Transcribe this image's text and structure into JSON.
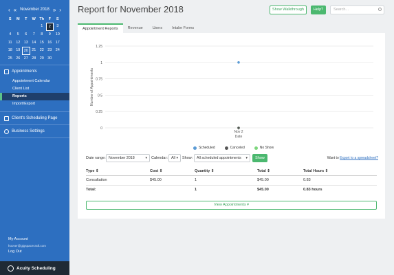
{
  "sidebar": {
    "calendar": {
      "prev": "‹",
      "next": "›",
      "month_label": "November 2018",
      "prev_year": "«",
      "next_year": "»",
      "weekdays": [
        "S",
        "M",
        "T",
        "W",
        "Th",
        "F",
        "S"
      ],
      "days": [
        {
          "d": "",
          "other": false
        },
        {
          "d": "",
          "other": false
        },
        {
          "d": "",
          "other": false
        },
        {
          "d": "",
          "other": false
        },
        {
          "d": "1",
          "other": false
        },
        {
          "d": "2",
          "selected": true
        },
        {
          "d": "3"
        },
        {
          "d": "4"
        },
        {
          "d": "5"
        },
        {
          "d": "6"
        },
        {
          "d": "7"
        },
        {
          "d": "8"
        },
        {
          "d": "9"
        },
        {
          "d": "10"
        },
        {
          "d": "11"
        },
        {
          "d": "12"
        },
        {
          "d": "13"
        },
        {
          "d": "14"
        },
        {
          "d": "15"
        },
        {
          "d": "16"
        },
        {
          "d": "17"
        },
        {
          "d": "18"
        },
        {
          "d": "19"
        },
        {
          "d": "20",
          "boxed": true
        },
        {
          "d": "21"
        },
        {
          "d": "22"
        },
        {
          "d": "23"
        },
        {
          "d": "24"
        },
        {
          "d": "25"
        },
        {
          "d": "26"
        },
        {
          "d": "27"
        },
        {
          "d": "28"
        },
        {
          "d": "29"
        },
        {
          "d": "30"
        },
        {
          "d": ""
        }
      ]
    },
    "nav": {
      "appointments": "Appointments",
      "appointment_calendar": "Appointment Calendar",
      "client_list": "Client List",
      "reports": "Reports",
      "import_export": "Import/Export",
      "scheduling_page": "Client's Scheduling Page",
      "business_settings": "Business Settings"
    },
    "account": {
      "my_account": "My Account",
      "email": "hoover@gigspacecraft.com",
      "logout": "Log Out"
    },
    "brand": "Acuity Scheduling"
  },
  "header": {
    "title": "Report for November 2018",
    "walkthrough": "Show Walkthrough",
    "help": "Help?",
    "search_placeholder": "Search..."
  },
  "tabs": [
    "Appointment Reports",
    "Revenue",
    "Users",
    "Intake Forms"
  ],
  "chart_data": {
    "type": "line",
    "ylabel": "Number of Appointments",
    "xlabel": "Date",
    "ylim": [
      0,
      1.25
    ],
    "yticks": [
      "1.25",
      "1",
      "0.75",
      "0.5",
      "0.25",
      "0"
    ],
    "categories": [
      "Nov 2"
    ],
    "series": [
      {
        "name": "Scheduled",
        "values": [
          1
        ],
        "color": "#5b9bd5"
      },
      {
        "name": "Canceled",
        "values": [
          0
        ],
        "color": "#555555"
      },
      {
        "name": "No Show",
        "values": [
          0
        ],
        "color": "#7dd67d"
      }
    ],
    "legend_position": "bottom"
  },
  "filters": {
    "date_range_label": "Date range:",
    "date_range_value": "November 2018",
    "calendar_label": "Calendar:",
    "calendar_value": "All",
    "show_label": "Show:",
    "show_value": "All scheduled appointments",
    "show_button": "Show",
    "export_prefix": "Want to ",
    "export_link": "Export to a spreadsheet?"
  },
  "table": {
    "headers": [
      "Type ⇕",
      "Cost ⇕",
      "Quantity ⇕",
      "Total ⇕",
      "Total Hours ⇕"
    ],
    "rows": [
      [
        "Consultation",
        "$45.00",
        "1",
        "$45.00",
        "0.83"
      ]
    ],
    "total": [
      "Total:",
      "",
      "1",
      "$45.00",
      "0.83 hours"
    ]
  },
  "view_appointments": "View Appointments ▾"
}
